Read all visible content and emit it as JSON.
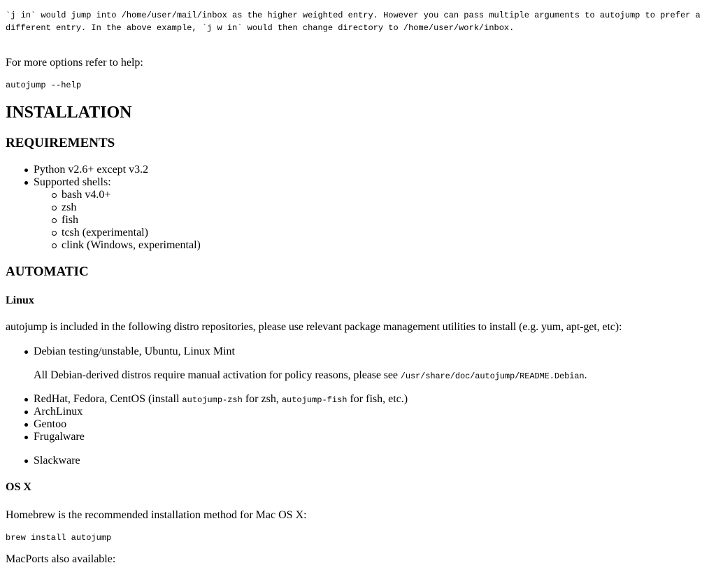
{
  "intro_pre": "`j in` would jump into /home/user/mail/inbox as the higher\nweighted entry. However you can pass multiple arguments to autojump\nto prefer a different entry. In the above example, `j w in` would\nthen change directory to /home/user/work/inbox.",
  "help_text": "For more options refer to help:",
  "help_cmd": "autojump --help",
  "installation": "INSTALLATION",
  "requirements": "REQUIREMENTS",
  "req_python": "Python v2.6+ except v3.2",
  "req_shells": "Supported shells:",
  "shells": [
    "bash v4.0+",
    "zsh",
    "fish",
    "tcsh (experimental)",
    "clink (Windows, experimental)"
  ],
  "automatic": "AUTOMATIC",
  "linux": "Linux",
  "linux_para": "autojump is included in the following distro repositories, please use relevant package management utilities to install (e.g. yum, apt-get, etc):",
  "debian": "Debian testing/unstable, Ubuntu, Linux Mint",
  "debian_note": "All Debian-derived distros require manual activation for policy reasons, please see ",
  "debian_path": "/usr/share/doc/autojump/README.Debian",
  "debian_end": ".",
  "redhat_a": "RedHat, Fedora, CentOS (install ",
  "redhat_code1": "autojump-zsh",
  "redhat_b": " for zsh, ",
  "redhat_code2": "autojump-fish",
  "redhat_c": " for fish, etc.)",
  "distros": [
    "ArchLinux",
    "Gentoo",
    "Frugalware"
  ],
  "slackware": "Slackware",
  "osx": "OS X",
  "homebrew": "Homebrew is the recommended installation method for Mac OS X:",
  "brew_cmd": "brew install autojump",
  "macports": "MacPorts also available:"
}
